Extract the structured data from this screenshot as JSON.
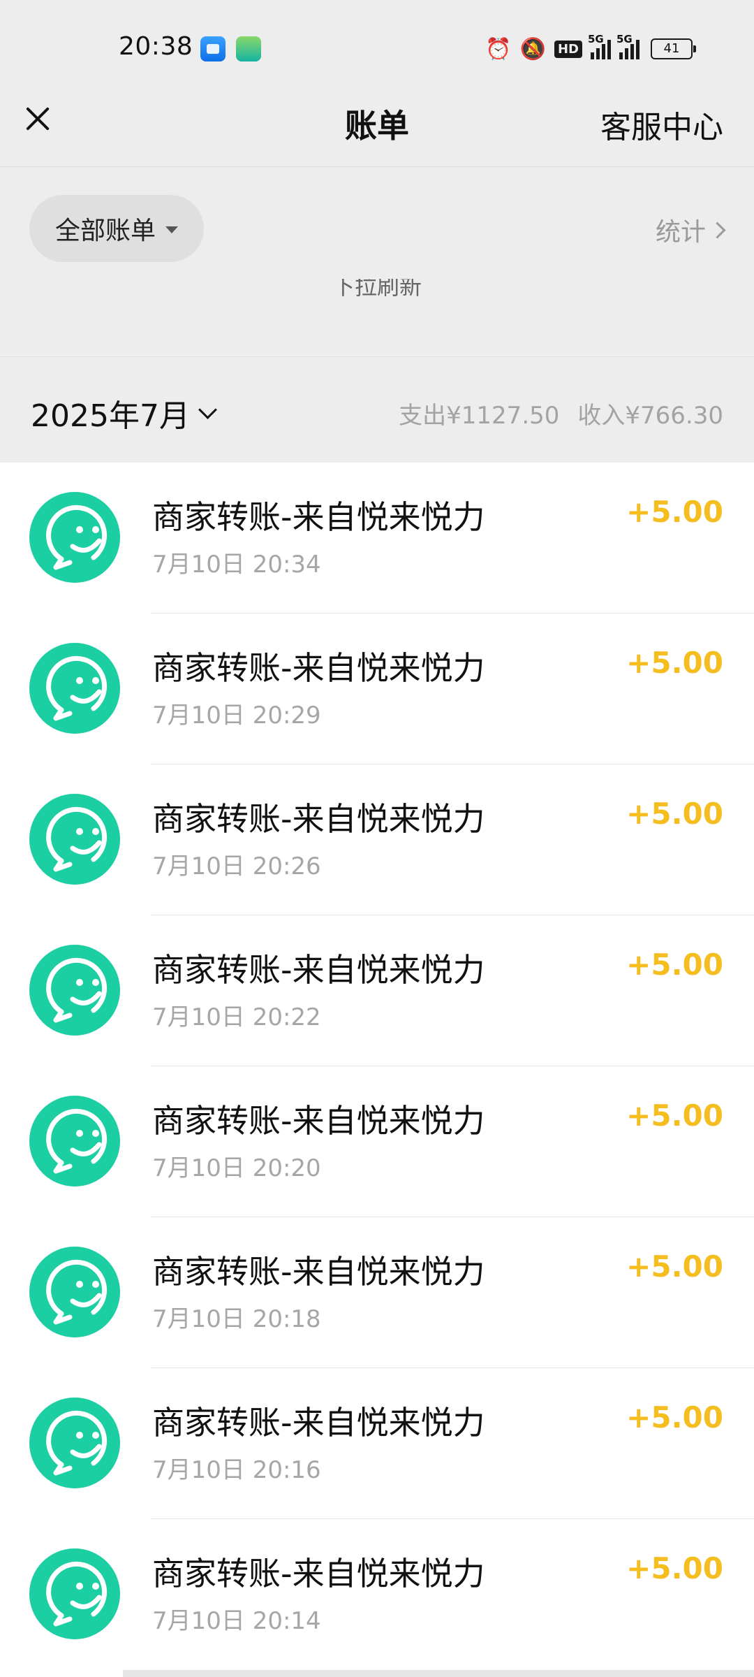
{
  "status_bar": {
    "time": "20:38",
    "signal1_label": "5G",
    "signal2_label": "5G",
    "hd_label": "HD",
    "battery_level": "41",
    "icons": [
      "app-icon-blue",
      "app-icon-green",
      "alarm-icon",
      "mute-icon",
      "hd-icon",
      "signal-icon",
      "signal-icon",
      "battery-icon"
    ]
  },
  "nav": {
    "title": "账单",
    "right_action": "客服中心",
    "left_icon": "close-icon"
  },
  "filter": {
    "chip_label": "全部账单",
    "stats_label": "统计",
    "pull_refresh_text": "下拉刷新"
  },
  "month": {
    "label": "2025年7月",
    "expense": "支出¥1127.50",
    "income": "收入¥766.30"
  },
  "colors": {
    "accent_green": "#1bcfa3",
    "amount_yellow": "#f5bd1f",
    "background_gray": "#ededed"
  },
  "transactions": [
    {
      "title": "商家转账-来自悦来悦力",
      "time": "7月10日 20:34",
      "amount": "+5.00"
    },
    {
      "title": "商家转账-来自悦来悦力",
      "time": "7月10日 20:29",
      "amount": "+5.00"
    },
    {
      "title": "商家转账-来自悦来悦力",
      "time": "7月10日 20:26",
      "amount": "+5.00"
    },
    {
      "title": "商家转账-来自悦来悦力",
      "time": "7月10日 20:22",
      "amount": "+5.00"
    },
    {
      "title": "商家转账-来自悦来悦力",
      "time": "7月10日 20:20",
      "amount": "+5.00"
    },
    {
      "title": "商家转账-来自悦来悦力",
      "time": "7月10日 20:18",
      "amount": "+5.00"
    },
    {
      "title": "商家转账-来自悦来悦力",
      "time": "7月10日 20:16",
      "amount": "+5.00"
    },
    {
      "title": "商家转账-来自悦来悦力",
      "time": "7月10日 20:14",
      "amount": "+5.00"
    }
  ]
}
